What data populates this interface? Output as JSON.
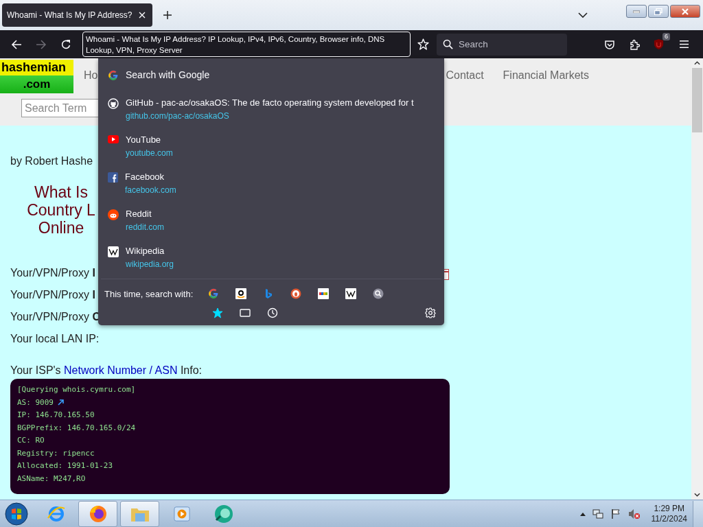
{
  "browser_tabs": [
    {
      "title": "Whoami - What Is My IP Address?",
      "selected": true
    }
  ],
  "toolbar": {
    "forward_disabled": true,
    "url": "Whoami - What Is My IP Address? IP Lookup, IPv4, IPv6, Country, Browser info, DNS Lookup, VPN, Proxy Server",
    "search_placeholder": "Search",
    "extension_badge": "6"
  },
  "site": {
    "logo": [
      "hashemian",
      ".com"
    ],
    "nav": [
      "Ho",
      "Contact",
      "Financial Markets"
    ],
    "search_placeholder": "Search Term",
    "byline": "by Robert Hashe",
    "headline": [
      "What Is",
      "Country L",
      "Online"
    ],
    "rows": [
      "Your/VPN/Proxy **I**",
      "Your/VPN/Proxy **I**",
      "Your/VPN/Proxy **C**",
      "Your local LAN IP:"
    ],
    "isp": {
      "before": "Your ISP's ",
      "link": "Network Number / ASN",
      "after": " Info:"
    },
    "whois": [
      {
        "text": "[Querying whois.cymru.com]",
        "link": false
      },
      {
        "text": "AS: 9009",
        "link": true
      },
      {
        "text": "IP: 146.70.165.50",
        "link": false
      },
      {
        "text": "BGPPrefix: 146.70.165.0/24",
        "link": false
      },
      {
        "text": "CC: RO",
        "link": false
      },
      {
        "text": "Registry: ripencc",
        "link": false
      },
      {
        "text": "Allocated: 1991-01-23",
        "link": false
      },
      {
        "text": "ASName: M247,RO",
        "link": false
      }
    ]
  },
  "dropdown": {
    "search": "Search with Google",
    "results": [
      {
        "title": "GitHub - pac-ac/osakaOS: The de facto operating system developed for t",
        "url": "github.com/pac-ac/osakaOS"
      },
      {
        "title": "YouTube",
        "url": "youtube.com"
      },
      {
        "title": "Facebook",
        "url": "facebook.com"
      },
      {
        "title": "Reddit",
        "url": "reddit.com"
      },
      {
        "title": "Wikipedia",
        "url": "wikipedia.org"
      }
    ],
    "footer_label": "This time, search with:"
  },
  "taskbar": {
    "time": "1:29 PM",
    "date": "11/2/2024"
  }
}
